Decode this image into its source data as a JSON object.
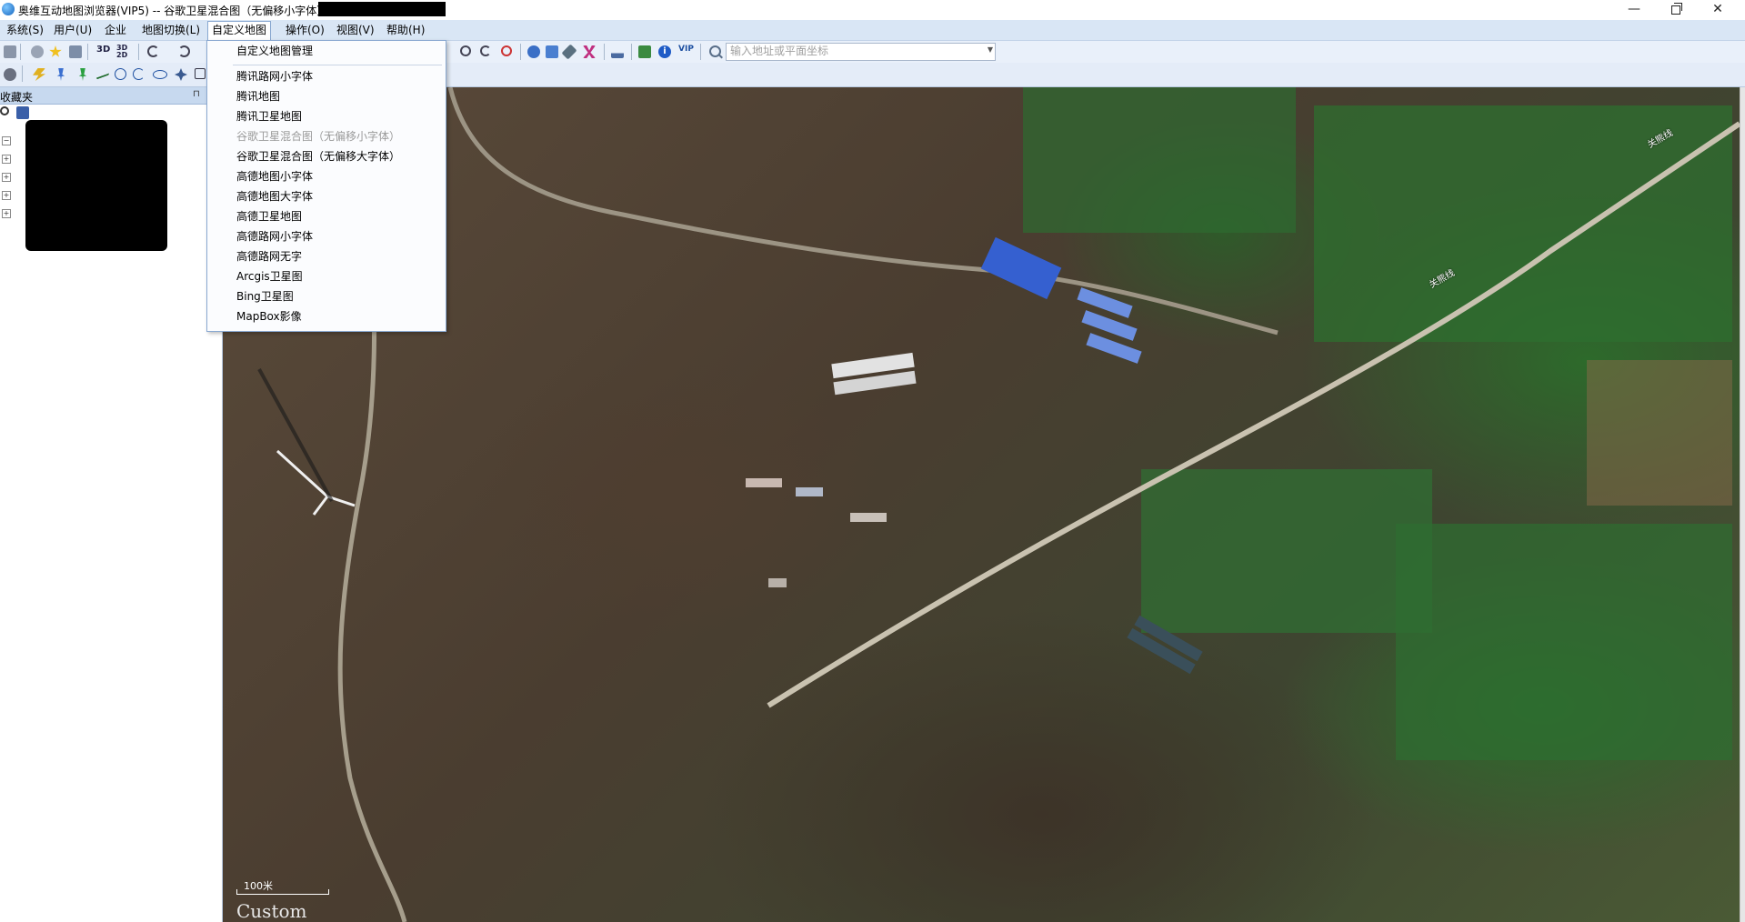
{
  "window": {
    "title": "奥维互动地图浏览器(VIP5) -- 谷歌卫星混合图（无偏移小字体）"
  },
  "menubar": {
    "items": [
      {
        "label": "系统(S)"
      },
      {
        "label": "用户(U)"
      },
      {
        "label": "企业"
      },
      {
        "label": "地图切换(L)"
      },
      {
        "label": "自定义地图"
      },
      {
        "label": "操作(O)"
      },
      {
        "label": "视图(V)"
      },
      {
        "label": "帮助(H)"
      }
    ]
  },
  "toolbar": {
    "label_3d": "3D",
    "label_3d2d": "3D 2D",
    "label_vip": "VIP",
    "search_placeholder": "输入地址或平面坐标"
  },
  "sidebar": {
    "title": "收藏夹",
    "pin": "ᵽ"
  },
  "dropdown": {
    "items": [
      {
        "label": "自定义地图管理",
        "enabled": true
      },
      {
        "label": "腾讯路网小字体",
        "enabled": true
      },
      {
        "label": "腾讯地图",
        "enabled": true
      },
      {
        "label": "腾讯卫星地图",
        "enabled": true
      },
      {
        "label": "谷歌卫星混合图（无偏移小字体）",
        "enabled": false
      },
      {
        "label": "谷歌卫星混合图（无偏移大字体）",
        "enabled": true
      },
      {
        "label": "高德地图小字体",
        "enabled": true
      },
      {
        "label": "高德地图大字体",
        "enabled": true
      },
      {
        "label": "高德卫星地图",
        "enabled": true
      },
      {
        "label": "高德路网小字体",
        "enabled": true
      },
      {
        "label": "高德路网无字",
        "enabled": true
      },
      {
        "label": "Arcgis卫星图",
        "enabled": true
      },
      {
        "label": "Bing卫星图",
        "enabled": true
      },
      {
        "label": "MapBox影像",
        "enabled": true
      }
    ]
  },
  "map": {
    "scale_label": "100米",
    "watermark": "Custom",
    "road_label": "关熊线"
  }
}
